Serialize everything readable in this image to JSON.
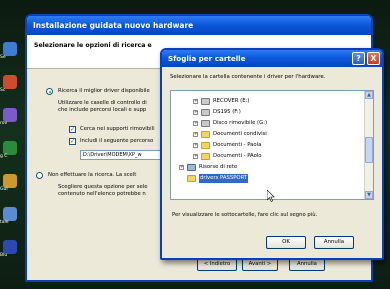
{
  "desktop": {
    "icons": [
      {
        "label": "Se",
        "icon": "app-icon",
        "color": "#3c7bd6"
      },
      {
        "label": "Sc",
        "icon": "shortcut-icon",
        "color": "#d04a2c"
      },
      {
        "label": "rov",
        "icon": "folder-icon",
        "color": "#7a5cc8"
      },
      {
        "label": "g C",
        "icon": "app-icon",
        "color": "#2a8c3a"
      },
      {
        "label": "Gui",
        "icon": "app-icon",
        "color": "#cc9a2a"
      },
      {
        "label": "tale",
        "icon": "app-icon",
        "color": "#5a8ad0"
      },
      {
        "label": "Blu",
        "icon": "app-icon",
        "color": "#2a4ab0"
      }
    ]
  },
  "wizard": {
    "title": "Installazione guidata nuovo hardware",
    "header_title": "Selezionare le opzioni di ricerca e",
    "option_search_label": "Ricerca il miglior driver disponibile",
    "option_search_desc": "Utilizzare le caselle di controllo di",
    "option_search_desc2": "che include percorsi locali e supp",
    "check_removable_label": "Cerca nei supporti rimovibili",
    "check_include_label": "Includi il seguente percorso",
    "path_value": "D:\\Driver\\MODEM\\XP_w",
    "option_manual_label": "Non effettuare la ricerca. La scelt",
    "option_manual_desc": "Scegliere questa opzione per sele",
    "option_manual_desc2": "contenuto nell'elenco potrebbe n",
    "back_button": "< Indietro",
    "next_button": "Avanti >",
    "cancel_button": "Annulla"
  },
  "browse_dialog": {
    "title": "Sfoglia per cartelle",
    "help_glyph": "?",
    "close_glyph": "X",
    "description": "Selezionare la cartella contenente i driver per l'hardware.",
    "tree": [
      {
        "label": "RECOVER (E:)",
        "icon": "drive-icon",
        "expander": "+",
        "depth": 1
      },
      {
        "label": "DS195 (F:)",
        "icon": "drive-icon",
        "expander": "+",
        "depth": 1
      },
      {
        "label": "Disco rimovibile (G:)",
        "icon": "drive-icon",
        "expander": "+",
        "depth": 1
      },
      {
        "label": "Documenti condivisi",
        "icon": "folder-icon",
        "expander": "+",
        "depth": 1
      },
      {
        "label": "Documenti - Paola",
        "icon": "folder-icon",
        "expander": "+",
        "depth": 1
      },
      {
        "label": "Documenti - PAolo",
        "icon": "folder-icon",
        "expander": "+",
        "depth": 1
      },
      {
        "label": "Risorse di rete",
        "icon": "network-icon",
        "expander": "+",
        "depth": 0
      },
      {
        "label": "drivers PASSPORT",
        "icon": "folder-icon",
        "expander": "",
        "depth": 0,
        "selected": true
      }
    ],
    "hint": "Per visualizzare le sottocartelle, fare clic sul segno più.",
    "ok_button": "OK",
    "cancel_button": "Annulla"
  }
}
